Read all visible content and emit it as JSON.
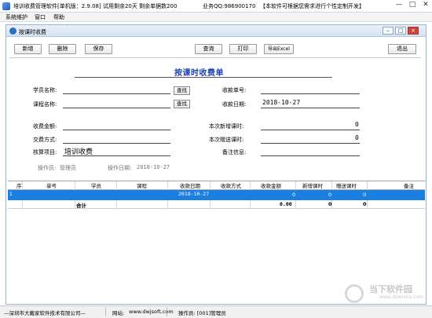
{
  "window": {
    "title": "培训收费管理软件[单机版：2.9.08]  试用剩余20天  剩余单据数200",
    "qq": "业务QQ:986900170",
    "notice": "【本软件可根据您需求进行个性定制开发】",
    "min": "—",
    "max": "□",
    "close": "✕"
  },
  "menu": [
    "系统维护",
    "窗口",
    "帮助"
  ],
  "child": {
    "title": "按课时收费",
    "min": "–",
    "max": "□",
    "close": "×"
  },
  "toolbar": {
    "add": "新增",
    "delete": "删除",
    "save": "保存",
    "query": "查询",
    "print": "打印",
    "export": "导出Excel",
    "exit": "退出"
  },
  "form": {
    "title": "按课时收费单",
    "student_label": "学员名称:",
    "student_value": "",
    "course_label": "课程名称:",
    "course_value": "",
    "find_label": "查找",
    "receipt_no_label": "收款单号:",
    "receipt_no_value": "",
    "receipt_date_label": "收款日期:",
    "receipt_date_value": "2018-10-27",
    "amount_label": "收费金额:",
    "amount_value": "",
    "payment_label": "交费方式:",
    "payment_value": "",
    "item_label": "核算项目:",
    "item_value": "培训收费",
    "new_hours_label": "本次新增课时:",
    "new_hours_value": "0",
    "gift_hours_label": "本次赠送课时:",
    "gift_hours_value": "0",
    "remark_label": "备注信息:",
    "remark_value": "",
    "operator_label": "操作员:",
    "operator_value": "管理员",
    "op_date_label": "操作日期:",
    "op_date_value": "2018-10-27"
  },
  "grid": {
    "columns": [
      "序",
      "单号",
      "学员",
      "课程",
      "收款日期",
      "收款方式",
      "收款金额",
      "新增课时",
      "赠送课时",
      "备注"
    ],
    "rows": [
      {
        "index": "1",
        "receipt_no": "",
        "student": "",
        "course": "",
        "date": "2018-10-27",
        "method": "",
        "amount": "0",
        "new_hours": "0",
        "gift_hours": "0",
        "remark": ""
      }
    ],
    "total": {
      "label": "合计",
      "amount": "0.00",
      "new_hours": "0",
      "gift_hours": "0"
    }
  },
  "status": {
    "company": "—深圳市大戴家软件技术有限公司—",
    "website_label": "网站:",
    "website": "www.dwjsoft.com",
    "operator": "操作员: [001]管理员"
  },
  "watermark": {
    "text": "当下软件园",
    "sub": "www.downxia.com"
  },
  "colors": {
    "selection": "#1b7fe0",
    "title_blue": "#1a3fb5"
  }
}
